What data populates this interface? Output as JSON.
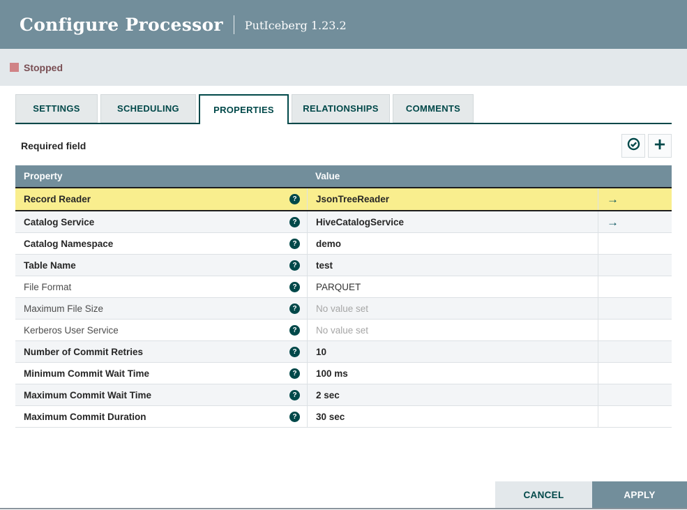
{
  "dialog": {
    "title": "Configure Processor",
    "subtitle": "PutIceberg 1.23.2"
  },
  "status": {
    "label": "Stopped",
    "color": "#D08386",
    "text_color": "#794E53"
  },
  "tabs": [
    {
      "label": "SETTINGS",
      "active": false
    },
    {
      "label": "SCHEDULING",
      "active": false
    },
    {
      "label": "PROPERTIES",
      "active": true
    },
    {
      "label": "RELATIONSHIPS",
      "active": false
    },
    {
      "label": "COMMENTS",
      "active": false
    }
  ],
  "properties_panel": {
    "required_field_label": "Required field",
    "actions": [
      {
        "icon": "verify-check-circle-icon"
      },
      {
        "icon": "add-property-plus-icon"
      }
    ],
    "table": {
      "columns": [
        "Property",
        "Value"
      ],
      "empty_value_text": "No value set",
      "rows": [
        {
          "property": "Record Reader",
          "value": "JsonTreeReader",
          "required": true,
          "selected": true,
          "goto": true
        },
        {
          "property": "Catalog Service",
          "value": "HiveCatalogService",
          "required": true,
          "selected": false,
          "goto": true
        },
        {
          "property": "Catalog Namespace",
          "value": "demo",
          "required": true,
          "selected": false,
          "goto": false
        },
        {
          "property": "Table Name",
          "value": "test",
          "required": true,
          "selected": false,
          "goto": false
        },
        {
          "property": "File Format",
          "value": "PARQUET",
          "required": false,
          "selected": false,
          "goto": false
        },
        {
          "property": "Maximum File Size",
          "value": null,
          "required": false,
          "selected": false,
          "goto": false
        },
        {
          "property": "Kerberos User Service",
          "value": null,
          "required": false,
          "selected": false,
          "goto": false
        },
        {
          "property": "Number of Commit Retries",
          "value": "10",
          "required": true,
          "selected": false,
          "goto": false
        },
        {
          "property": "Minimum Commit Wait Time",
          "value": "100 ms",
          "required": true,
          "selected": false,
          "goto": false
        },
        {
          "property": "Maximum Commit Wait Time",
          "value": "2 sec",
          "required": true,
          "selected": false,
          "goto": false
        },
        {
          "property": "Maximum Commit Duration",
          "value": "30 sec",
          "required": true,
          "selected": false,
          "goto": false
        }
      ]
    }
  },
  "footer": {
    "cancel_label": "CANCEL",
    "apply_label": "APPLY"
  },
  "colors": {
    "accent_teal": "#004849",
    "header_slate": "#728E9B",
    "selected_row_yellow": "#F9EE8E",
    "bar_gray": "#E3E8EB"
  }
}
